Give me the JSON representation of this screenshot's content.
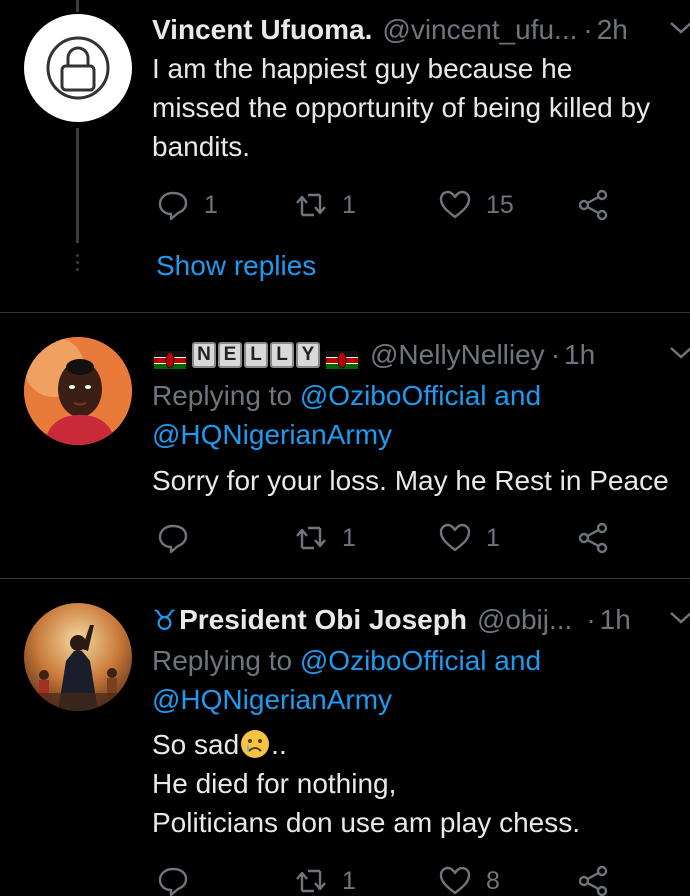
{
  "tweets": [
    {
      "name": "Vincent Ufuoma.",
      "handle": "@vincent_ufu...",
      "separator": "·",
      "time": "2h",
      "avatar_icon": "lock-icon",
      "lines": [
        "I am the happiest guy because he",
        "missed the opportunity of being killed by",
        "bandits."
      ],
      "reply_count": "1",
      "retweet_count": "1",
      "like_count": "15",
      "show_replies": "Show replies"
    },
    {
      "name_letters": [
        "N",
        "E",
        "L",
        "L",
        "Y"
      ],
      "handle": "@NellyNelliey",
      "separator": "·",
      "time": "1h",
      "replying_prefix": "Replying to",
      "replying_to_1": "@OziboOfficial",
      "replying_and": "and",
      "replying_to_2": "@HQNigerianArmy",
      "lines": [
        "Sorry for your loss. May he Rest in Peace"
      ],
      "reply_count": "",
      "retweet_count": "1",
      "like_count": "1"
    },
    {
      "name_prefix": "♉",
      "name": "President Obi Joseph",
      "handle": "@obij...",
      "separator": "·",
      "time": "1h",
      "replying_prefix": "Replying to",
      "replying_to_1": "@OziboOfficial",
      "replying_and": "and",
      "replying_to_2": "@HQNigerianArmy",
      "line1": "So sad",
      "line1_suffix": "..",
      "lines": [
        "He died for nothing,",
        "Politicians don use am play chess."
      ],
      "reply_count": "",
      "retweet_count": "1",
      "like_count": "8"
    }
  ],
  "colors": {
    "background": "#000000",
    "text": "#e7e9ea",
    "muted": "#6e767d",
    "link": "#1d9bf0",
    "divider": "#2f3336"
  }
}
